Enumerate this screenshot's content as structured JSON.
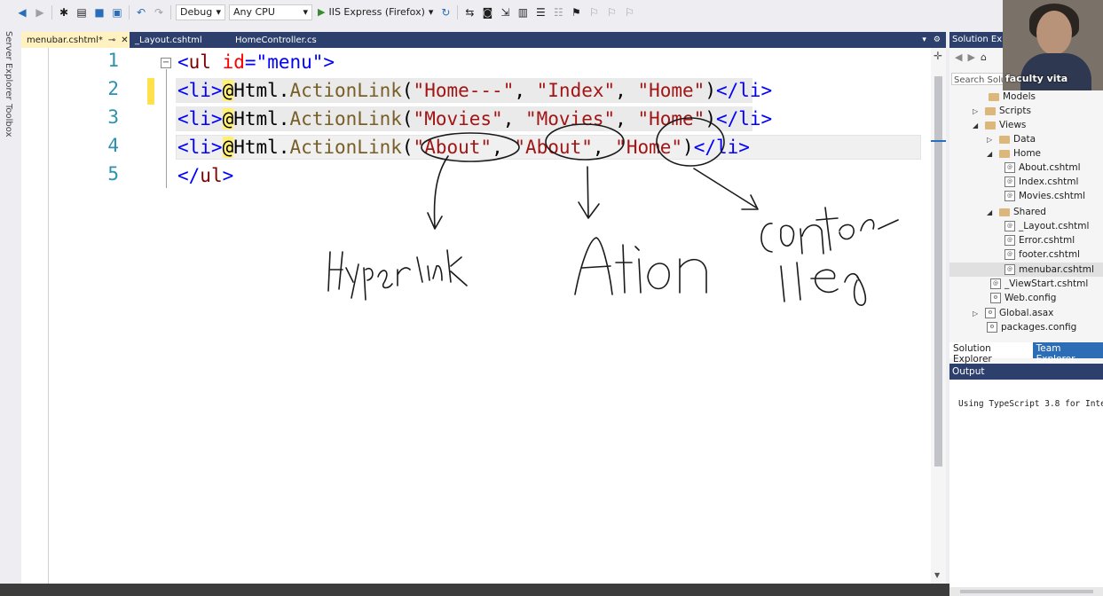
{
  "toolbar": {
    "config_select": "Debug",
    "platform_select": "Any CPU",
    "run_target": "IIS Express (Firefox)"
  },
  "left_strip": {
    "server_explorer": "Server Explorer",
    "toolbox": "Toolbox"
  },
  "tabs": [
    {
      "label": "menubar.cshtml*",
      "active": true
    },
    {
      "label": "_Layout.cshtml",
      "active": false
    },
    {
      "label": "HomeController.cs",
      "active": false
    }
  ],
  "editor": {
    "lines": [
      {
        "num": "1",
        "tag_open": "<",
        "tag_name": "ul",
        "attr": " id",
        "eq": "=",
        "val": "\"menu\"",
        "tag_close": ">"
      },
      {
        "num": "2",
        "li_open": "<li>",
        "at": "@",
        "html": "Html.",
        "method": "ActionLink",
        "paren_open": "(",
        "arg1": "\"Home---\"",
        "sep1": ", ",
        "arg2": "\"Index\"",
        "sep2": ", ",
        "arg3": "\"Home\"",
        "paren_close": ")",
        "li_close": "</li>"
      },
      {
        "num": "3",
        "li_open": "<li>",
        "at": "@",
        "html": "Html.",
        "method": "ActionLink",
        "paren_open": "(",
        "arg1": "\"Movies\"",
        "sep1": ", ",
        "arg2": "\"Movies\"",
        "sep2": ", ",
        "arg3": "\"Home\"",
        "paren_close": ")",
        "li_close": "</li>"
      },
      {
        "num": "4",
        "li_open": "<li>",
        "at": "@",
        "html": "Html.",
        "method": "ActionLink",
        "paren_open": "(",
        "arg1": "\"About\"",
        "sep1": ", ",
        "arg2": "\"About\"",
        "sep2": ", ",
        "arg3": "\"Home\"",
        "paren_close": ")",
        "li_close": "</li>"
      },
      {
        "num": "5",
        "tag_open": "</",
        "tag_name": "ul",
        "tag_close": ">"
      }
    ],
    "annotations": {
      "hyperlink": "Hyperlink",
      "action": "Action",
      "controller_line1": "contro",
      "controller_line2": "ller"
    }
  },
  "solution_explorer": {
    "title": "Solution Exp",
    "search_placeholder": "Search Solu",
    "items": [
      {
        "label": "Models",
        "kind": "folder",
        "arrow": ""
      },
      {
        "label": "Scripts",
        "kind": "folder",
        "arrow": "▷"
      },
      {
        "label": "Views",
        "kind": "folder",
        "arrow": "◢"
      },
      {
        "label": "Data",
        "kind": "folder",
        "arrow": "▷"
      },
      {
        "label": "Home",
        "kind": "folder",
        "arrow": "◢"
      },
      {
        "label": "About.cshtml",
        "kind": "file",
        "arrow": ""
      },
      {
        "label": "Index.cshtml",
        "kind": "file",
        "arrow": ""
      },
      {
        "label": "Movies.cshtml",
        "kind": "file",
        "arrow": ""
      },
      {
        "label": "Shared",
        "kind": "folder",
        "arrow": "◢"
      },
      {
        "label": "_Layout.cshtml",
        "kind": "file",
        "arrow": ""
      },
      {
        "label": "Error.cshtml",
        "kind": "file",
        "arrow": ""
      },
      {
        "label": "footer.cshtml",
        "kind": "file",
        "arrow": ""
      },
      {
        "label": "menubar.cshtml",
        "kind": "file",
        "arrow": "",
        "selected": true
      },
      {
        "label": "_ViewStart.cshtml",
        "kind": "file",
        "arrow": ""
      },
      {
        "label": "Web.config",
        "kind": "config",
        "arrow": ""
      },
      {
        "label": "Global.asax",
        "kind": "config",
        "arrow": "▷"
      },
      {
        "label": "packages.config",
        "kind": "config",
        "arrow": ""
      }
    ],
    "bottom_tabs": {
      "solution": "Solution Explorer",
      "team": "Team Explorer"
    }
  },
  "output": {
    "title": "Output",
    "text": "Using TypeScript 3.8 for Inte"
  },
  "webcam": {
    "label": "faculty vita"
  }
}
